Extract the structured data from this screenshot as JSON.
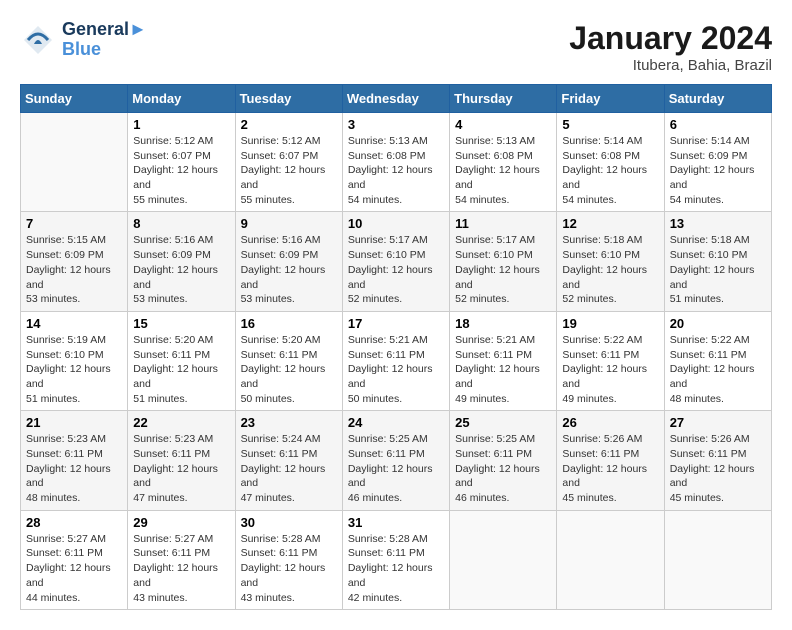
{
  "header": {
    "logo_line1": "General",
    "logo_line2": "Blue",
    "title": "January 2024",
    "subtitle": "Itubera, Bahia, Brazil"
  },
  "columns": [
    "Sunday",
    "Monday",
    "Tuesday",
    "Wednesday",
    "Thursday",
    "Friday",
    "Saturday"
  ],
  "weeks": [
    [
      {
        "day": "",
        "sunrise": "",
        "sunset": "",
        "daylight": ""
      },
      {
        "day": "1",
        "sunrise": "Sunrise: 5:12 AM",
        "sunset": "Sunset: 6:07 PM",
        "daylight": "Daylight: 12 hours and 55 minutes."
      },
      {
        "day": "2",
        "sunrise": "Sunrise: 5:12 AM",
        "sunset": "Sunset: 6:07 PM",
        "daylight": "Daylight: 12 hours and 55 minutes."
      },
      {
        "day": "3",
        "sunrise": "Sunrise: 5:13 AM",
        "sunset": "Sunset: 6:08 PM",
        "daylight": "Daylight: 12 hours and 54 minutes."
      },
      {
        "day": "4",
        "sunrise": "Sunrise: 5:13 AM",
        "sunset": "Sunset: 6:08 PM",
        "daylight": "Daylight: 12 hours and 54 minutes."
      },
      {
        "day": "5",
        "sunrise": "Sunrise: 5:14 AM",
        "sunset": "Sunset: 6:08 PM",
        "daylight": "Daylight: 12 hours and 54 minutes."
      },
      {
        "day": "6",
        "sunrise": "Sunrise: 5:14 AM",
        "sunset": "Sunset: 6:09 PM",
        "daylight": "Daylight: 12 hours and 54 minutes."
      }
    ],
    [
      {
        "day": "7",
        "sunrise": "Sunrise: 5:15 AM",
        "sunset": "Sunset: 6:09 PM",
        "daylight": "Daylight: 12 hours and 53 minutes."
      },
      {
        "day": "8",
        "sunrise": "Sunrise: 5:16 AM",
        "sunset": "Sunset: 6:09 PM",
        "daylight": "Daylight: 12 hours and 53 minutes."
      },
      {
        "day": "9",
        "sunrise": "Sunrise: 5:16 AM",
        "sunset": "Sunset: 6:09 PM",
        "daylight": "Daylight: 12 hours and 53 minutes."
      },
      {
        "day": "10",
        "sunrise": "Sunrise: 5:17 AM",
        "sunset": "Sunset: 6:10 PM",
        "daylight": "Daylight: 12 hours and 52 minutes."
      },
      {
        "day": "11",
        "sunrise": "Sunrise: 5:17 AM",
        "sunset": "Sunset: 6:10 PM",
        "daylight": "Daylight: 12 hours and 52 minutes."
      },
      {
        "day": "12",
        "sunrise": "Sunrise: 5:18 AM",
        "sunset": "Sunset: 6:10 PM",
        "daylight": "Daylight: 12 hours and 52 minutes."
      },
      {
        "day": "13",
        "sunrise": "Sunrise: 5:18 AM",
        "sunset": "Sunset: 6:10 PM",
        "daylight": "Daylight: 12 hours and 51 minutes."
      }
    ],
    [
      {
        "day": "14",
        "sunrise": "Sunrise: 5:19 AM",
        "sunset": "Sunset: 6:10 PM",
        "daylight": "Daylight: 12 hours and 51 minutes."
      },
      {
        "day": "15",
        "sunrise": "Sunrise: 5:20 AM",
        "sunset": "Sunset: 6:11 PM",
        "daylight": "Daylight: 12 hours and 51 minutes."
      },
      {
        "day": "16",
        "sunrise": "Sunrise: 5:20 AM",
        "sunset": "Sunset: 6:11 PM",
        "daylight": "Daylight: 12 hours and 50 minutes."
      },
      {
        "day": "17",
        "sunrise": "Sunrise: 5:21 AM",
        "sunset": "Sunset: 6:11 PM",
        "daylight": "Daylight: 12 hours and 50 minutes."
      },
      {
        "day": "18",
        "sunrise": "Sunrise: 5:21 AM",
        "sunset": "Sunset: 6:11 PM",
        "daylight": "Daylight: 12 hours and 49 minutes."
      },
      {
        "day": "19",
        "sunrise": "Sunrise: 5:22 AM",
        "sunset": "Sunset: 6:11 PM",
        "daylight": "Daylight: 12 hours and 49 minutes."
      },
      {
        "day": "20",
        "sunrise": "Sunrise: 5:22 AM",
        "sunset": "Sunset: 6:11 PM",
        "daylight": "Daylight: 12 hours and 48 minutes."
      }
    ],
    [
      {
        "day": "21",
        "sunrise": "Sunrise: 5:23 AM",
        "sunset": "Sunset: 6:11 PM",
        "daylight": "Daylight: 12 hours and 48 minutes."
      },
      {
        "day": "22",
        "sunrise": "Sunrise: 5:23 AM",
        "sunset": "Sunset: 6:11 PM",
        "daylight": "Daylight: 12 hours and 47 minutes."
      },
      {
        "day": "23",
        "sunrise": "Sunrise: 5:24 AM",
        "sunset": "Sunset: 6:11 PM",
        "daylight": "Daylight: 12 hours and 47 minutes."
      },
      {
        "day": "24",
        "sunrise": "Sunrise: 5:25 AM",
        "sunset": "Sunset: 6:11 PM",
        "daylight": "Daylight: 12 hours and 46 minutes."
      },
      {
        "day": "25",
        "sunrise": "Sunrise: 5:25 AM",
        "sunset": "Sunset: 6:11 PM",
        "daylight": "Daylight: 12 hours and 46 minutes."
      },
      {
        "day": "26",
        "sunrise": "Sunrise: 5:26 AM",
        "sunset": "Sunset: 6:11 PM",
        "daylight": "Daylight: 12 hours and 45 minutes."
      },
      {
        "day": "27",
        "sunrise": "Sunrise: 5:26 AM",
        "sunset": "Sunset: 6:11 PM",
        "daylight": "Daylight: 12 hours and 45 minutes."
      }
    ],
    [
      {
        "day": "28",
        "sunrise": "Sunrise: 5:27 AM",
        "sunset": "Sunset: 6:11 PM",
        "daylight": "Daylight: 12 hours and 44 minutes."
      },
      {
        "day": "29",
        "sunrise": "Sunrise: 5:27 AM",
        "sunset": "Sunset: 6:11 PM",
        "daylight": "Daylight: 12 hours and 43 minutes."
      },
      {
        "day": "30",
        "sunrise": "Sunrise: 5:28 AM",
        "sunset": "Sunset: 6:11 PM",
        "daylight": "Daylight: 12 hours and 43 minutes."
      },
      {
        "day": "31",
        "sunrise": "Sunrise: 5:28 AM",
        "sunset": "Sunset: 6:11 PM",
        "daylight": "Daylight: 12 hours and 42 minutes."
      },
      {
        "day": "",
        "sunrise": "",
        "sunset": "",
        "daylight": ""
      },
      {
        "day": "",
        "sunrise": "",
        "sunset": "",
        "daylight": ""
      },
      {
        "day": "",
        "sunrise": "",
        "sunset": "",
        "daylight": ""
      }
    ]
  ]
}
